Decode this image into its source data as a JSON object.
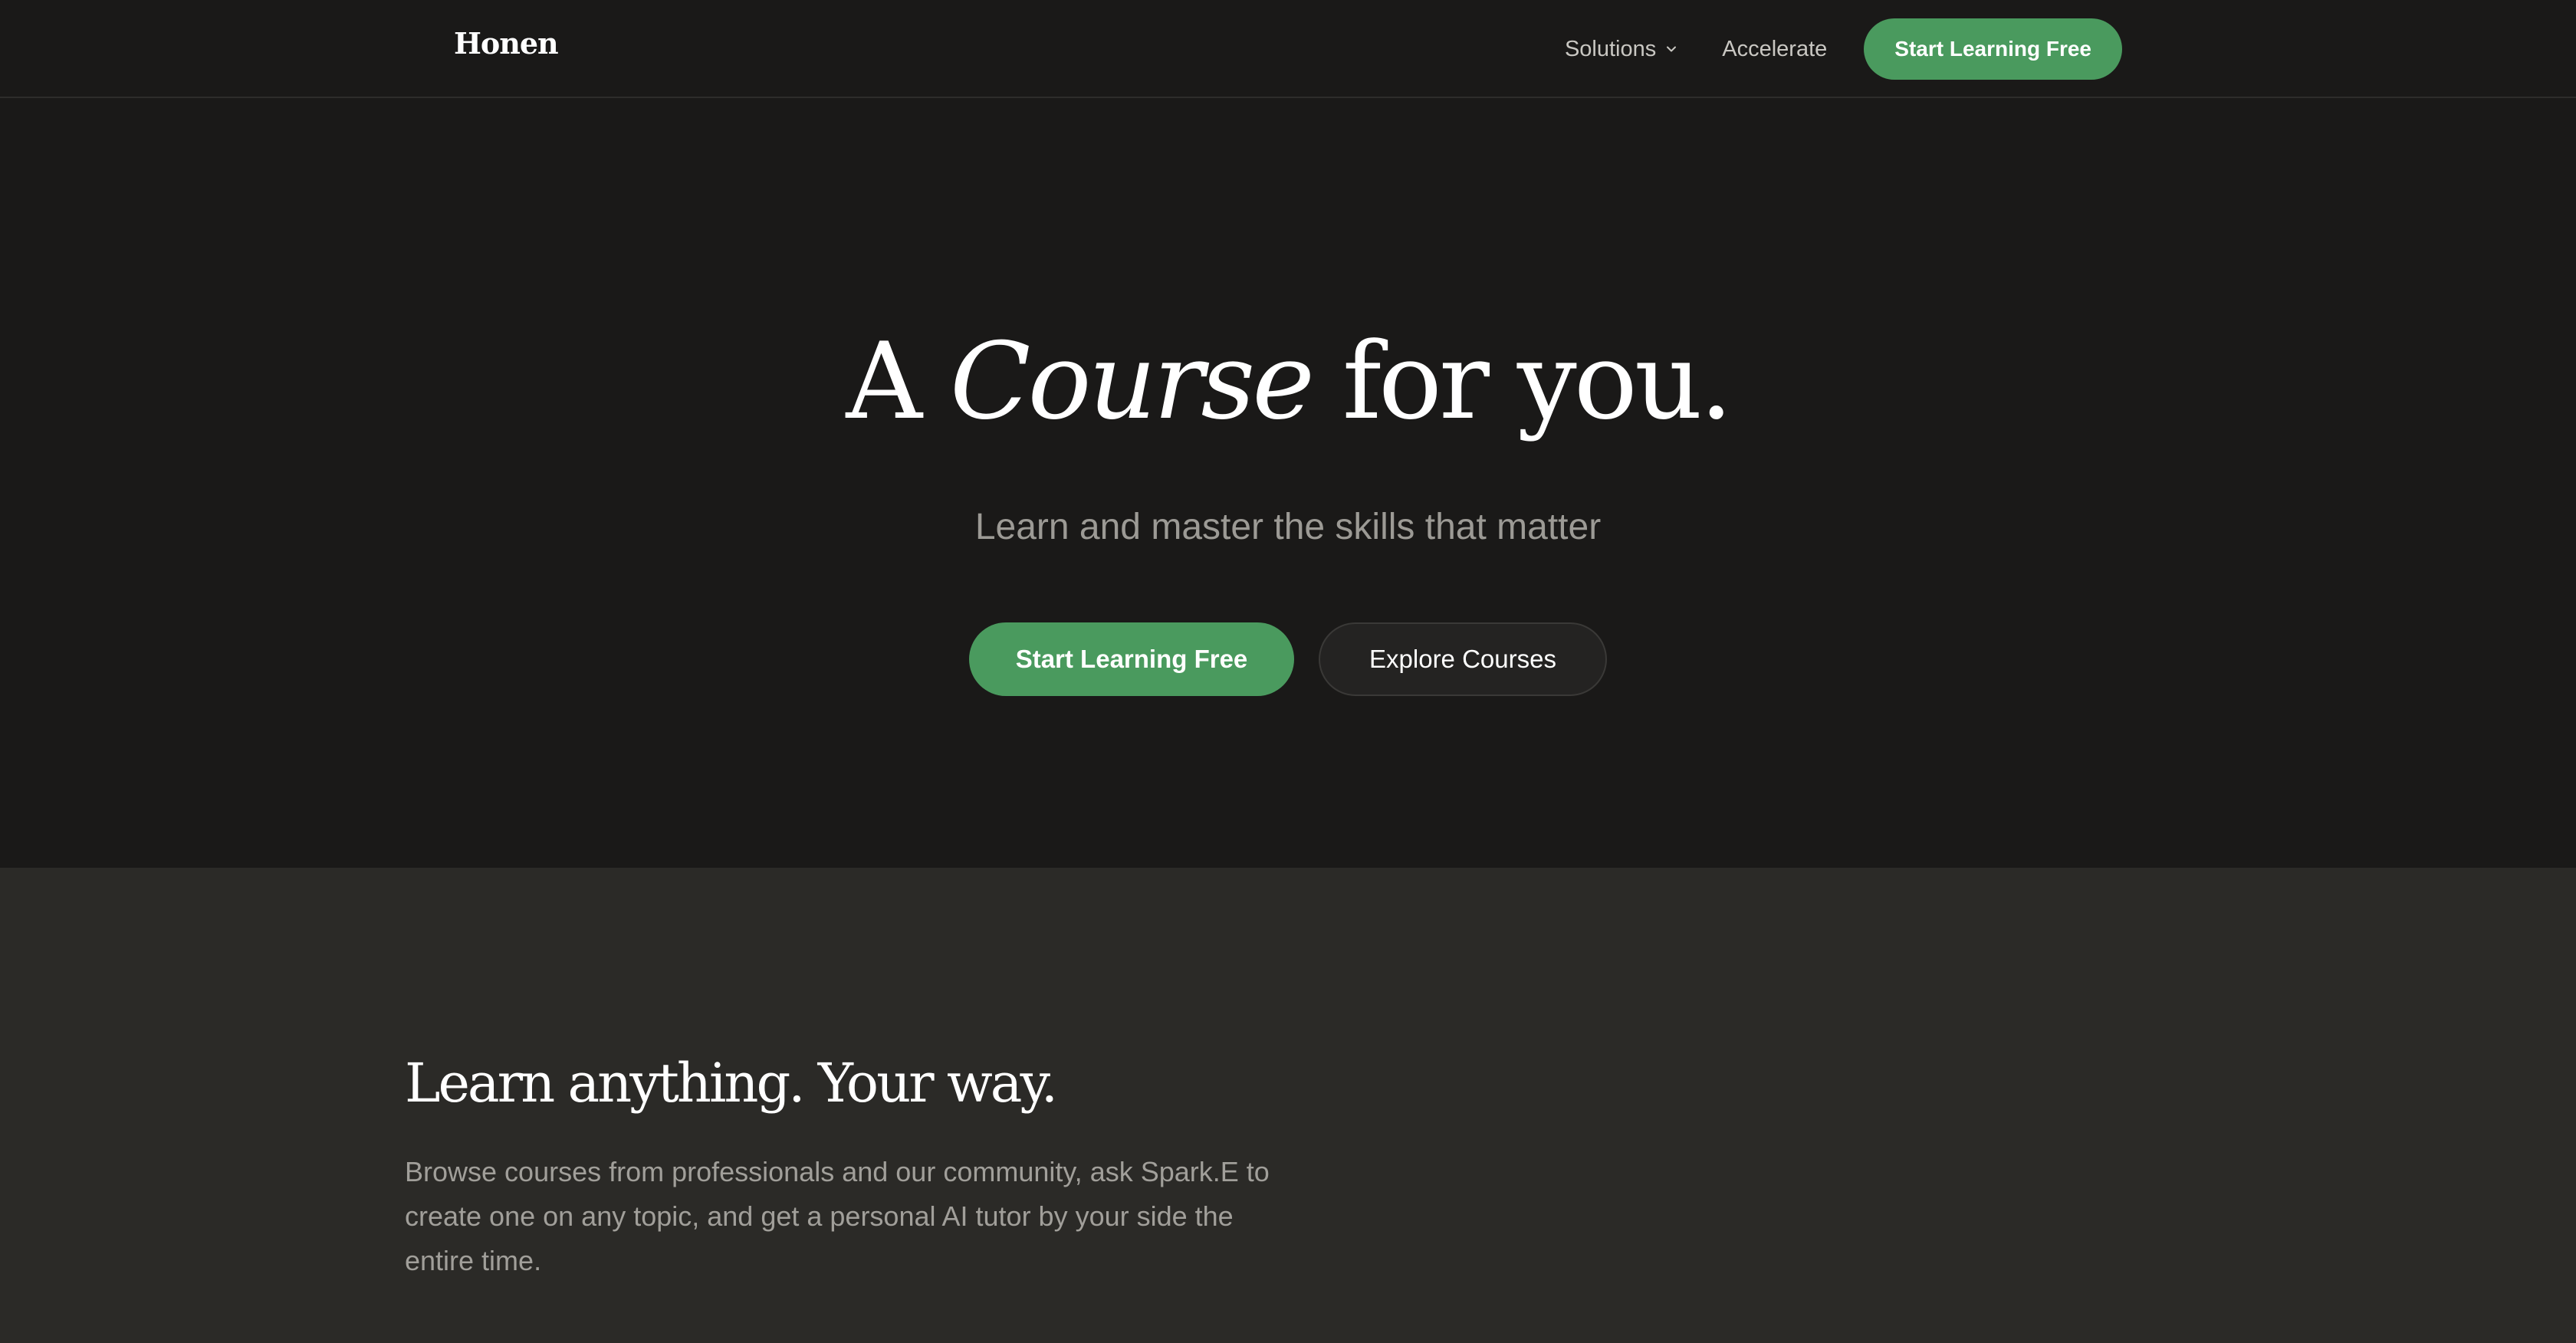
{
  "brand": {
    "name": "Honen"
  },
  "nav": {
    "solutions_label": "Solutions",
    "accelerate_label": "Accelerate",
    "cta_label": "Start Learning Free"
  },
  "hero": {
    "title_part1": "A ",
    "title_emphasis": "Course",
    "title_part2": " for you.",
    "subtitle": "Learn and master the skills that matter",
    "primary_cta": "Start Learning Free",
    "secondary_cta": "Explore Courses"
  },
  "feature": {
    "title": "Learn anything. Your way.",
    "body": "Browse courses from professionals and our community, ask Spark.E to create one on any topic, and get a personal AI tutor by your side the entire time."
  },
  "icons": {
    "solutions_dropdown": "chevron-down-icon"
  },
  "colors": {
    "background": "#1a1918",
    "section_background": "#2b2a27",
    "accent_green": "#4a9a5e",
    "muted_text": "#9c9a95"
  }
}
